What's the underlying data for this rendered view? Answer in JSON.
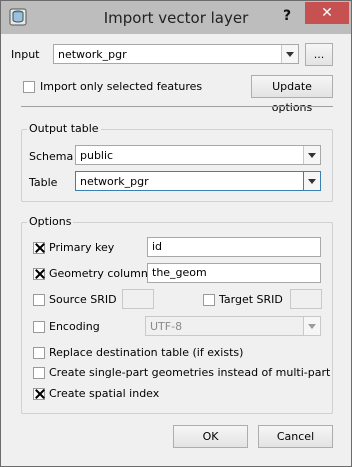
{
  "window": {
    "title": "Import vector layer",
    "help_label": "?",
    "close_label": "✕"
  },
  "input": {
    "label": "Input",
    "value": "network_pgr",
    "browse_label": "..."
  },
  "import_selected": {
    "label": "Import only selected features",
    "checked": false
  },
  "update_options_label": "Update options",
  "output_table": {
    "title": "Output table",
    "schema_label": "Schema",
    "schema_value": "public",
    "table_label": "Table",
    "table_value": "network_pgr"
  },
  "options": {
    "title": "Options",
    "primary_key": {
      "label": "Primary key",
      "value": "id",
      "checked": true
    },
    "geometry_column": {
      "label": "Geometry column",
      "value": "the_geom",
      "checked": true
    },
    "source_srid": {
      "label": "Source SRID",
      "value": "",
      "checked": false
    },
    "target_srid": {
      "label": "Target SRID",
      "value": "",
      "checked": false
    },
    "encoding": {
      "label": "Encoding",
      "value": "UTF-8",
      "checked": false
    },
    "replace_table": {
      "label": "Replace destination table (if exists)",
      "checked": false
    },
    "single_part": {
      "label": "Create single-part geometries instead of multi-part",
      "checked": false
    },
    "spatial_index": {
      "label": "Create spatial index",
      "checked": true
    }
  },
  "buttons": {
    "ok": "OK",
    "cancel": "Cancel"
  },
  "colors": {
    "titlebar": "#bdbdbd",
    "close": "#c75050",
    "focus": "#3c7fb1"
  }
}
